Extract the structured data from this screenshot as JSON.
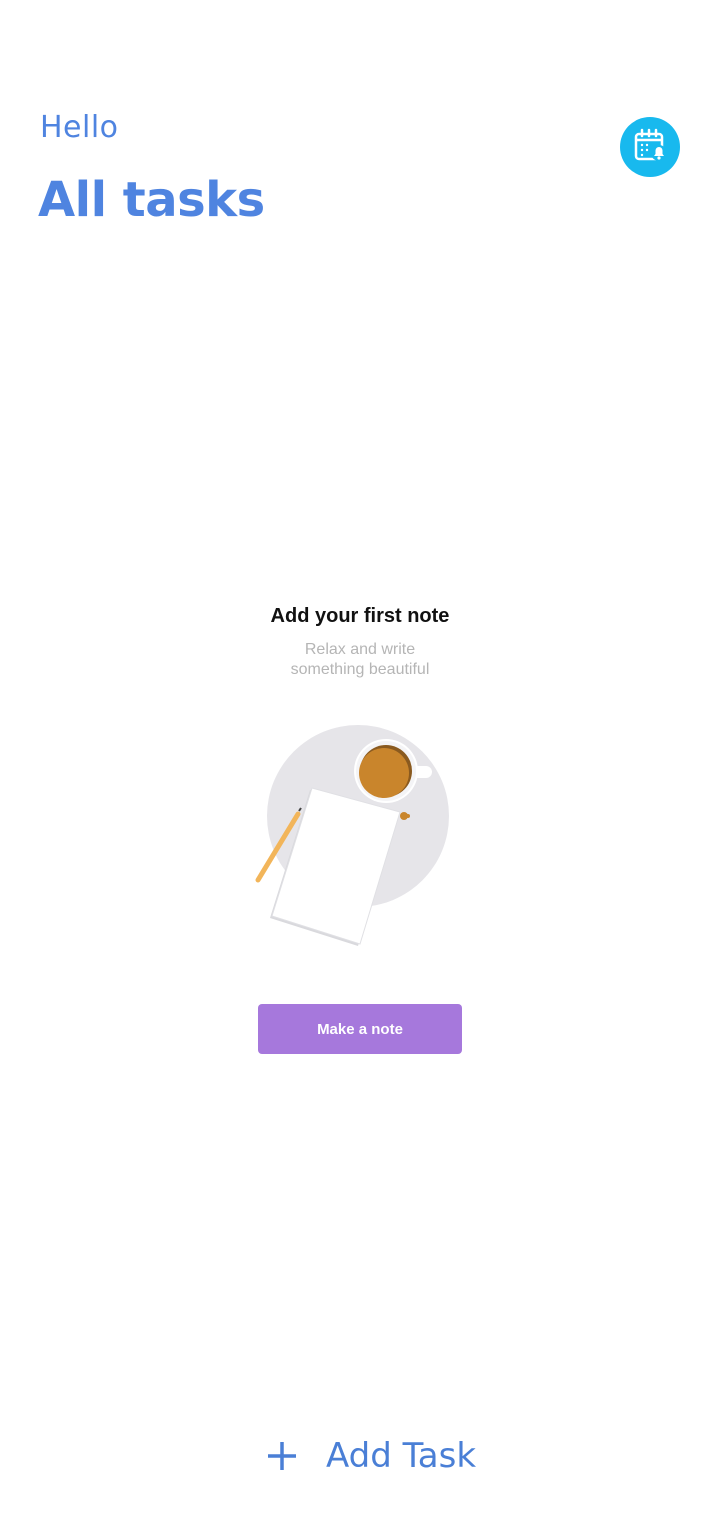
{
  "header": {
    "greeting": "Hello",
    "title": "All tasks",
    "calendar_button_icon": "calendar-reminder-icon"
  },
  "empty_state": {
    "title": "Add your first note",
    "subtitle_line1": "Relax and write",
    "subtitle_line2": "something beautiful",
    "illustration": "note-coffee-illustration",
    "button_label": "Make a note"
  },
  "footer": {
    "add_icon": "plus-icon",
    "add_label": "Add Task"
  },
  "colors": {
    "accent_blue": "#4f84e0",
    "calendar_bg": "#18b9ee",
    "button_purple": "#a678dc",
    "coffee": "#c9852c",
    "pencil": "#f2b55a"
  }
}
